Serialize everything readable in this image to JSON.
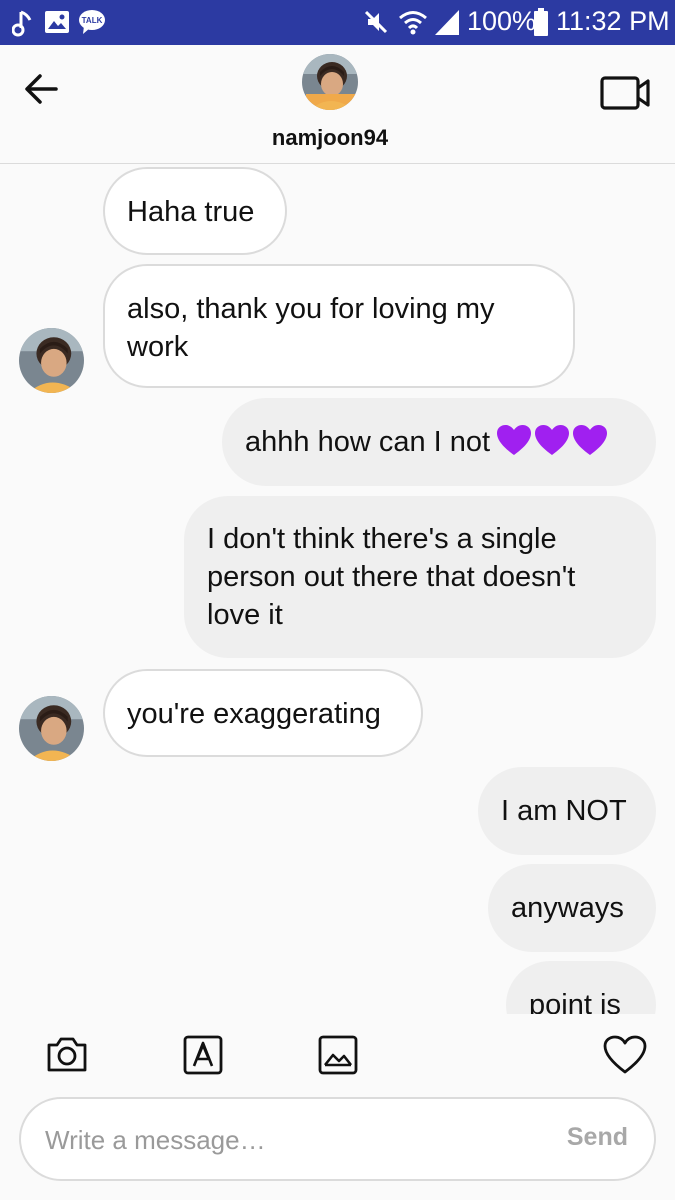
{
  "status_bar": {
    "battery": "100%",
    "time": "11:32 PM",
    "icons": [
      "music-note-icon",
      "gallery-icon",
      "kakaotalk-icon",
      "mute-icon",
      "wifi-icon",
      "signal-icon",
      "battery-icon"
    ],
    "talk_badge": "TALK",
    "background": "#2c3aa2"
  },
  "header": {
    "username": "namjoon94",
    "back_icon": "arrow-left-icon",
    "video_icon": "video-camera-icon"
  },
  "messages": [
    {
      "from": "them",
      "text_lines": [
        "Haha true"
      ]
    },
    {
      "from": "them",
      "text_lines": [
        "also, thank you for loving my",
        "work"
      ]
    },
    {
      "from": "me",
      "text_lines": [
        "ahhh how can I not"
      ],
      "emoji": "purple-heart-icon x3"
    },
    {
      "from": "me",
      "text_lines": [
        "I don't think there's a single",
        "person out there that doesn't",
        "love it"
      ]
    },
    {
      "from": "them",
      "text_lines": [
        "you're exaggerating"
      ]
    },
    {
      "from": "me",
      "text_lines": [
        "I am NOT"
      ]
    },
    {
      "from": "me",
      "text_lines": [
        "anyways"
      ]
    },
    {
      "from": "me",
      "text_lines": [
        "point is"
      ]
    }
  ],
  "composer": {
    "placeholder": "Write a message…",
    "send_label": "Send",
    "tools": [
      "camera-icon",
      "text-style-icon",
      "gallery-icon",
      "heart-icon"
    ]
  },
  "colors": {
    "sent_bubble": "#efefef",
    "received_bubble": "#ffffff",
    "heart_emoji": "#9b1fe0"
  }
}
